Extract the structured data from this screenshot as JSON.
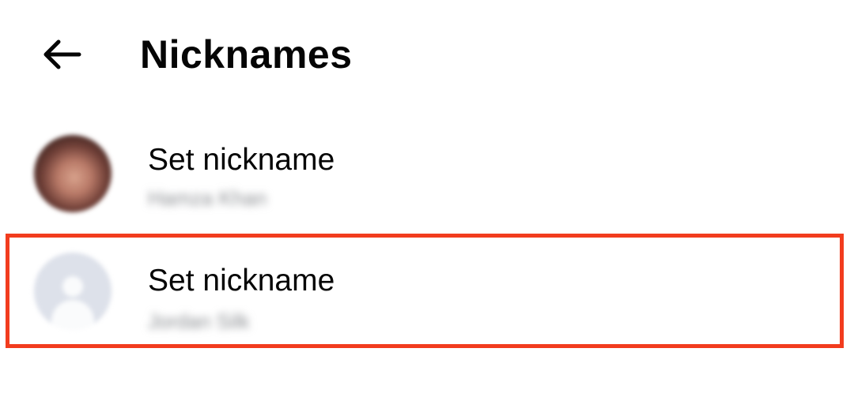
{
  "header": {
    "title": "Nicknames",
    "back_icon": "arrow-left-icon"
  },
  "participants": [
    {
      "label": "Set nickname",
      "name": "Hamza Khan",
      "avatar": "profile-photo"
    },
    {
      "label": "Set nickname",
      "name": "Jordan Silk",
      "avatar": "default-avatar-icon"
    }
  ],
  "colors": {
    "highlight": "#f23c1e",
    "text_primary": "#050505",
    "text_secondary": "#8a8d91",
    "default_avatar_bg": "#dde1ea"
  }
}
